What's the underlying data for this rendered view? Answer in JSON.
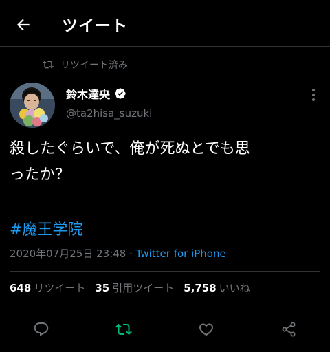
{
  "header": {
    "title": "ツイート",
    "back_icon": "arrow-left-icon"
  },
  "retweet_context": {
    "label": "リツイート済み",
    "icon": "retweet-icon"
  },
  "author": {
    "display_name": "鈴木達央",
    "handle": "@ta2hisa_suzuki",
    "verified": true
  },
  "tweet": {
    "text_line1": "殺したぐらいで、俺が死ぬとでも思",
    "text_line2": "ったか？",
    "hashtag": "#魔王学院",
    "timestamp": "2020年07月25日 23:48",
    "separator": " · ",
    "source": "Twitter for iPhone"
  },
  "stats": {
    "retweets_count": "648",
    "retweets_label": "リツイート",
    "quotes_count": "35",
    "quotes_label": "引用ツイート",
    "likes_count": "5,758",
    "likes_label": "いいね"
  },
  "colors": {
    "background": "#000000",
    "text": "#ffffff",
    "secondary_text": "#71767b",
    "link": "#1d9bf0",
    "retweet_active": "#00ba7c",
    "divider": "#2f3336"
  },
  "action_icons": [
    "reply-icon",
    "retweet-icon",
    "like-icon",
    "share-icon"
  ]
}
